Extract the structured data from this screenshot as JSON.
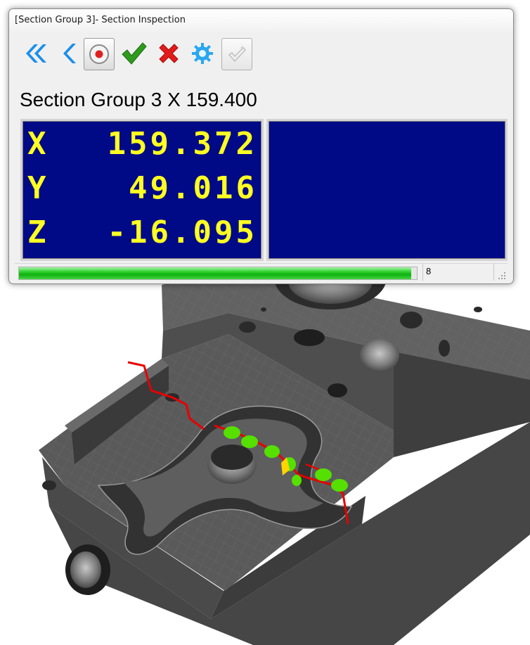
{
  "window": {
    "title": "[Section Group 3]- Section Inspection"
  },
  "toolbar": {
    "buttons": [
      {
        "name": "first-button",
        "icon": "double-chevron-left-icon"
      },
      {
        "name": "previous-button",
        "icon": "chevron-left-icon"
      },
      {
        "name": "record-button",
        "icon": "record-icon"
      },
      {
        "name": "accept-button",
        "icon": "checkmark-icon"
      },
      {
        "name": "reject-button",
        "icon": "x-mark-icon"
      },
      {
        "name": "settings-button",
        "icon": "gear-icon"
      },
      {
        "name": "disabled-button",
        "icon": "checkmark-sparkle-icon"
      }
    ]
  },
  "section": {
    "label": "Section Group 3 X  159.400"
  },
  "readout": {
    "x": {
      "axis": "X",
      "value": "159.372"
    },
    "y": {
      "axis": "Y",
      "value": "49.016"
    },
    "z": {
      "axis": "Z",
      "value": "-16.095"
    }
  },
  "status": {
    "progress": 0.985,
    "count": "8"
  },
  "colors": {
    "readout_background": "#000a87",
    "readout_text": "#ffff22",
    "progress": "#1bbf1b",
    "section_line": "#e60000",
    "measure_points": "#55e000",
    "highlight_point": "#ffd400",
    "model": "#585858"
  }
}
